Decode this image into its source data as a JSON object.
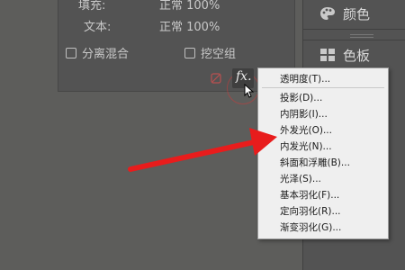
{
  "layer_panel": {
    "fill_label": "填充:",
    "fill_value": "正常 100%",
    "text_label": "文本:",
    "text_value": "正常 100%",
    "check_separate_blend": "分离混合",
    "check_knockout_group": "挖空组"
  },
  "right_panel": {
    "tab_color": "颜色",
    "tab_swatches": "色板"
  },
  "fx_button_label": "fx.",
  "context_menu": {
    "items": [
      "透明度(T)...",
      "投影(D)...",
      "内阴影(I)...",
      "外发光(O)...",
      "内发光(N)...",
      "斜面和浮雕(B)...",
      "光泽(S)...",
      "基本羽化(F)...",
      "定向羽化(R)...",
      "渐变羽化(G)..."
    ]
  },
  "colors": {
    "annotation_arrow": "#e81c1c",
    "panel_bg": "#535353",
    "menu_bg": "#efefef"
  },
  "icons": [
    "color-palette-icon",
    "swatches-icon",
    "fx-icon",
    "mouse-cursor-icon",
    "annotation-arrow-icon",
    "no-effect-icon"
  ]
}
